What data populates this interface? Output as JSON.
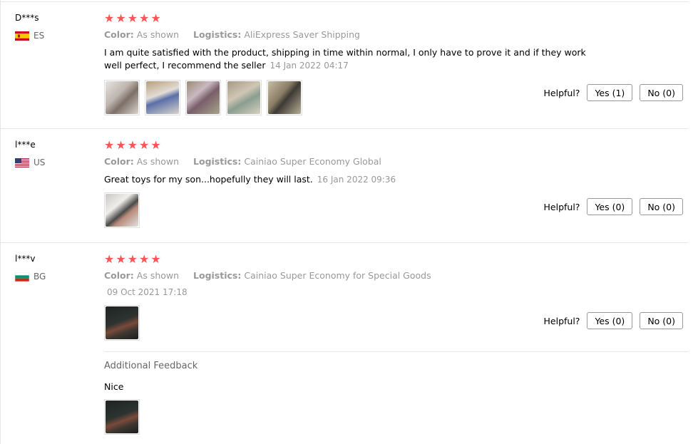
{
  "reviews": [
    {
      "user": "D***s",
      "country": "ES",
      "flag_colors": [
        "#c60b1e",
        "#ffc400",
        "#c60b1e"
      ],
      "stars": 5,
      "color_label": "Color:",
      "color_value": "As shown",
      "logistics_label": "Logistics:",
      "logistics_value": "AliExpress Saver Shipping",
      "text": "I am quite satisfied with the product, shipping in time within normal, I only have to prove it and if they work well perfect, I recommend the seller",
      "date": "14 Jan 2022 04:17",
      "helpful_label": "Helpful?",
      "yes_label": "Yes (1)",
      "no_label": "No (0)"
    },
    {
      "user": "l***e",
      "country": "US",
      "stars": 5,
      "color_label": "Color:",
      "color_value": "As shown",
      "logistics_label": "Logistics:",
      "logistics_value": "Cainiao Super Economy Global",
      "text": "Great toys for my son...hopefully they will last.",
      "date": "16 Jan 2022 09:36",
      "helpful_label": "Helpful?",
      "yes_label": "Yes (0)",
      "no_label": "No (0)"
    },
    {
      "user": "l***v",
      "country": "BG",
      "flag_colors": [
        "#ffffff",
        "#00966e",
        "#d62612"
      ],
      "stars": 5,
      "color_label": "Color:",
      "color_value": "As shown",
      "logistics_label": "Logistics:",
      "logistics_value": "Cainiao Super Economy for Special Goods",
      "text": "",
      "date": "09 Oct 2021 17:18",
      "helpful_label": "Helpful?",
      "yes_label": "Yes (0)",
      "no_label": "No (0)",
      "additional_title": "Additional Feedback",
      "additional_text": "Nice"
    }
  ],
  "accent_star_color": "#ff5555"
}
